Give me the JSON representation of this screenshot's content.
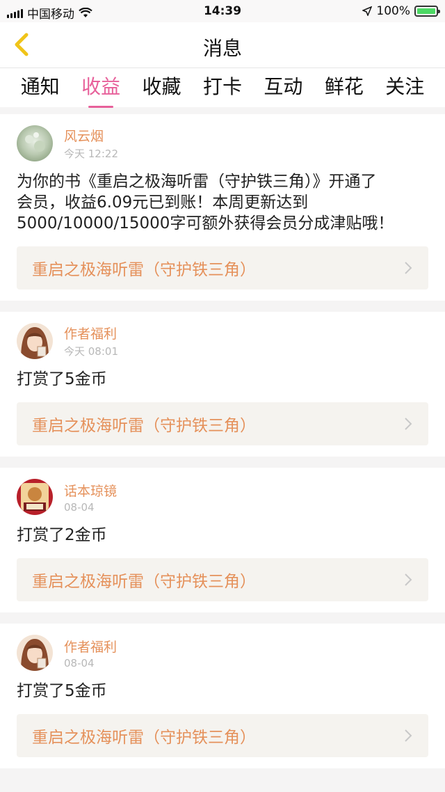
{
  "status_bar": {
    "carrier": "中国移动",
    "time": "14:39",
    "battery": "100%",
    "battery_level": 1.0
  },
  "nav": {
    "title": "消息"
  },
  "tabs": [
    {
      "label": "通知",
      "active": false
    },
    {
      "label": "收益",
      "active": true
    },
    {
      "label": "收藏",
      "active": false
    },
    {
      "label": "打卡",
      "active": false
    },
    {
      "label": "互动",
      "active": false
    },
    {
      "label": "鲜花",
      "active": false
    },
    {
      "label": "关注",
      "active": false
    }
  ],
  "messages": [
    {
      "name": "风云烟",
      "time": "今天 12:22",
      "text_lines": [
        "为你的书《重启之极海听雷（守护铁三角）》开通了",
        "会员，收益6.09元已到账！本周更新达到",
        "5000/10000/15000字可额外获得会员分成津贴哦！"
      ],
      "book": "重启之极海听雷（守护铁三角）"
    },
    {
      "name": "作者福利",
      "time": "今天 08:01",
      "text_lines": [
        "打赏了5金币"
      ],
      "book": "重启之极海听雷（守护铁三角）"
    },
    {
      "name": "话本琼镜",
      "time": "08-04",
      "text_lines": [
        "打赏了2金币"
      ],
      "book": "重启之极海听雷（守护铁三角）"
    },
    {
      "name": "作者福利",
      "time": "08-04",
      "text_lines": [
        "打赏了5金币"
      ],
      "book": "重启之极海听雷（守护铁三角）"
    }
  ],
  "colors": {
    "accent": "#e7609a",
    "name": "#e5915b",
    "back_icon": "#f0c419"
  },
  "icons": {
    "back": "chevron-left-icon",
    "link": "chevron-right-icon"
  }
}
